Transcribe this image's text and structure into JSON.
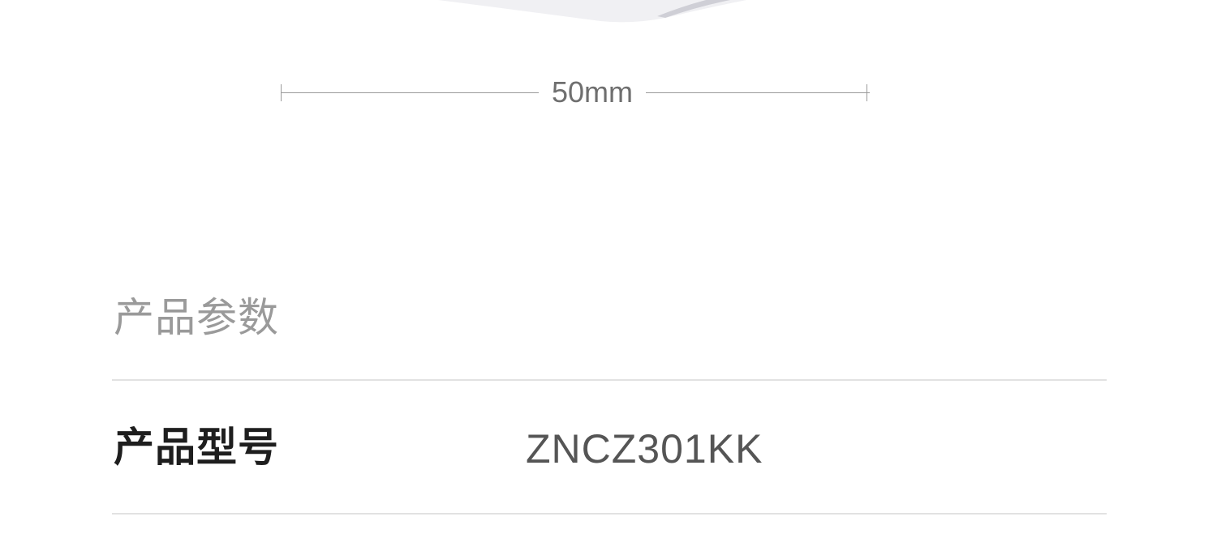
{
  "dimension": {
    "label": "50mm"
  },
  "section": {
    "title": "产品参数"
  },
  "params": [
    {
      "key": "产品型号",
      "value": "ZNCZ301KK"
    }
  ]
}
